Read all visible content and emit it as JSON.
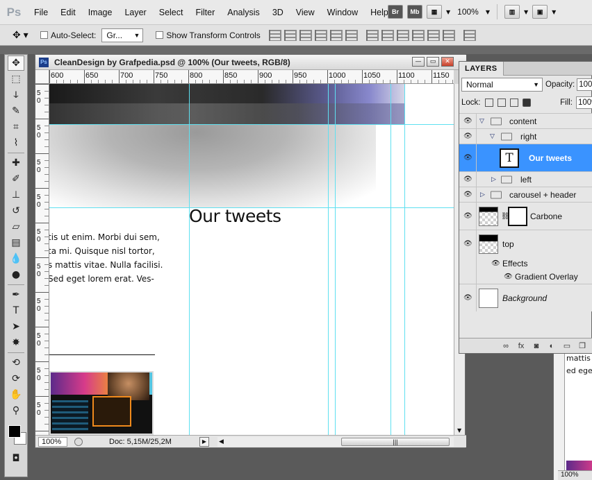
{
  "app": {
    "logo": "Ps"
  },
  "menu": [
    "File",
    "Edit",
    "Image",
    "Layer",
    "Select",
    "Filter",
    "Analysis",
    "3D",
    "View",
    "Window",
    "Help"
  ],
  "menubar_right": {
    "bridge": "Br",
    "minibridge": "Mb",
    "zoom": "100%"
  },
  "options_bar": {
    "auto_select_label": "Auto-Select:",
    "auto_select_value": "Gr...",
    "show_transform_label": "Show Transform Controls"
  },
  "document": {
    "title": "CleanDesign by Grafpedia.psd @ 100% (Our tweets, RGB/8)",
    "ruler_labels": [
      "600",
      "650",
      "700",
      "750",
      "800",
      "850",
      "900",
      "950",
      "1000",
      "1050",
      "1100",
      "1150"
    ],
    "vruler_labels": [
      [
        "5",
        "0"
      ],
      [
        "5",
        "0"
      ],
      [
        "5",
        "0"
      ],
      [
        "5",
        "0"
      ],
      [
        "5",
        "0"
      ],
      [
        "5",
        "0"
      ],
      [
        "5",
        "0"
      ],
      [
        "5",
        "0"
      ],
      [
        "5",
        "0"
      ],
      [
        "5",
        "0"
      ],
      [
        "5",
        "0"
      ],
      [
        "5",
        "0"
      ]
    ],
    "heading": "Our tweets",
    "body_lines": [
      "tis ut enim. Morbi dui sem,",
      "ta mi. Quisque nisl tortor,",
      "s mattis vitae. Nulla facilisi.",
      "Sed eget lorem erat. Ves-"
    ],
    "zoom": "100%",
    "doc_info": "Doc: 5,15M/25,2M"
  },
  "layers_panel": {
    "tab": "LAYERS",
    "blend_mode": "Normal",
    "opacity_label": "Opacity:",
    "opacity_value": "100%",
    "lock_label": "Lock:",
    "fill_label": "Fill:",
    "fill_value": "100%",
    "layers": [
      {
        "name": "content",
        "kind": "group",
        "expanded": true,
        "indent": 0
      },
      {
        "name": "right",
        "kind": "group",
        "expanded": true,
        "indent": 1
      },
      {
        "name": "Our tweets",
        "kind": "text",
        "selected": true,
        "indent": 2
      },
      {
        "name": "left",
        "kind": "group",
        "expanded": false,
        "indent": 1
      },
      {
        "name": "carousel + header",
        "kind": "group",
        "expanded": false,
        "indent": 0
      },
      {
        "name": "Carbone",
        "kind": "masked",
        "indent": 0
      },
      {
        "name": "top",
        "kind": "pixel",
        "indent": 0
      },
      {
        "name": "Effects",
        "kind": "effects"
      },
      {
        "name": "Gradient Overlay",
        "kind": "effect"
      },
      {
        "name": "Background",
        "kind": "background"
      }
    ],
    "footer_fx": "fx"
  },
  "background_doc": {
    "lines": [
      "mattis",
      "ed eget"
    ],
    "zoom": "100%"
  }
}
